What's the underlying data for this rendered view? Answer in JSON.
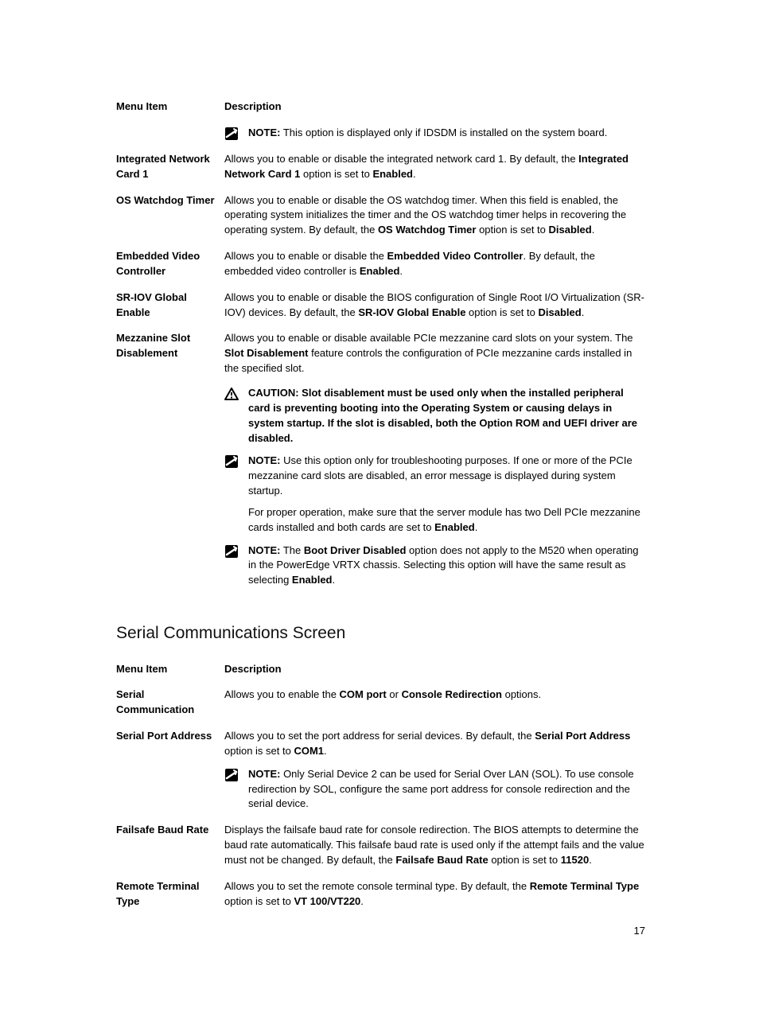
{
  "page_number": "17",
  "tables": {
    "t1": {
      "header_label": "Menu Item",
      "header_desc": "Description",
      "rows": {
        "idsdm": {
          "note_prefix": "NOTE:",
          "note_text": " This option is displayed only if IDSDM is installed on the system board."
        },
        "nic": {
          "label": "Integrated Network Card 1",
          "desc1": "Allows you to enable or disable the integrated network card 1. By default, the ",
          "desc2": "Integrated Network Card 1",
          "desc3": " option is set to ",
          "desc4": "Enabled",
          "desc5": "."
        },
        "oswd": {
          "label": "OS Watchdog Timer",
          "desc1": "Allows you to enable or disable the OS watchdog timer. When this field is enabled, the operating system initializes the timer and the OS watchdog timer helps in recovering the operating system. By default, the ",
          "desc2": "OS Watchdog Timer",
          "desc3": " option is set to ",
          "desc4": "Disabled",
          "desc5": "."
        },
        "evc": {
          "label": "Embedded Video Controller",
          "desc1": "Allows you to enable or disable the ",
          "desc2": "Embedded Video Controller",
          "desc3": ". By default, the embedded video controller is ",
          "desc4": "Enabled",
          "desc5": "."
        },
        "sriov": {
          "label": "SR-IOV Global Enable",
          "desc1": "Allows you to enable or disable the BIOS configuration of Single Root I/O Virtualization (SR-IOV) devices. By default, the ",
          "desc2": "SR-IOV Global Enable",
          "desc3": " option is set to ",
          "desc4": "Disabled",
          "desc5": "."
        },
        "mezz": {
          "label": "Mezzanine Slot Disablement",
          "desc1": "Allows you to enable or disable available PCIe mezzanine card slots on your system. The ",
          "desc2": "Slot Disablement",
          "desc3": " feature controls the configuration of PCIe mezzanine cards installed in the specified slot.",
          "caution_prefix": "CAUTION: ",
          "caution_text": "Slot disablement must be used only when the installed peripheral card is preventing booting into the Operating System or causing delays in system startup. If the slot is disabled, both the Option ROM and UEFI driver are disabled.",
          "note1_prefix": "NOTE:",
          "note1_p1": " Use this option only for troubleshooting purposes. If one or more of the PCIe mezzanine card slots are disabled, an error message is displayed during system startup.",
          "note1_p2a": "For proper operation, make sure that the server module has two Dell PCIe mezzanine cards installed and both cards are set to ",
          "note1_p2b": "Enabled",
          "note1_p2c": ".",
          "note2_prefix": "NOTE:",
          "note2a": " The ",
          "note2b": "Boot Driver Disabled",
          "note2c": " option does not apply to the M520 when operating in the PowerEdge VRTX chassis. Selecting this option will have the same result as selecting ",
          "note2d": "Enabled",
          "note2e": "."
        }
      }
    },
    "t2": {
      "heading": "Serial Communications Screen",
      "header_label": "Menu Item",
      "header_desc": "Description",
      "rows": {
        "scomm": {
          "label": "Serial Communication",
          "desc1": "Allows you to enable the ",
          "desc2": "COM port",
          "desc3": " or ",
          "desc4": "Console Redirection",
          "desc5": " options."
        },
        "spa": {
          "label": "Serial Port Address",
          "desc1": "Allows you to set the port address for serial devices. By default, the ",
          "desc2": "Serial Port Address",
          "desc3": " option is set to ",
          "desc4": "COM1",
          "desc5": ".",
          "note_prefix": "NOTE:",
          "note_text": " Only Serial Device 2 can be used for Serial Over LAN (SOL). To use console redirection by SOL, configure the same port address for console redirection and the serial device."
        },
        "fbr": {
          "label": "Failsafe Baud Rate",
          "desc1": "Displays the failsafe baud rate for console redirection. The BIOS attempts to determine the baud rate automatically. This failsafe baud rate is used only if the attempt fails and the value must not be changed. By default, the ",
          "desc2": "Failsafe Baud Rate",
          "desc3": " option is set to ",
          "desc4": "11520",
          "desc5": "."
        },
        "rtt": {
          "label": "Remote Terminal Type",
          "desc1": "Allows you to set the remote console terminal type. By default, the ",
          "desc2": "Remote Terminal Type",
          "desc3": " option is set to ",
          "desc4": "VT 100/VT220",
          "desc5": "."
        }
      }
    }
  }
}
